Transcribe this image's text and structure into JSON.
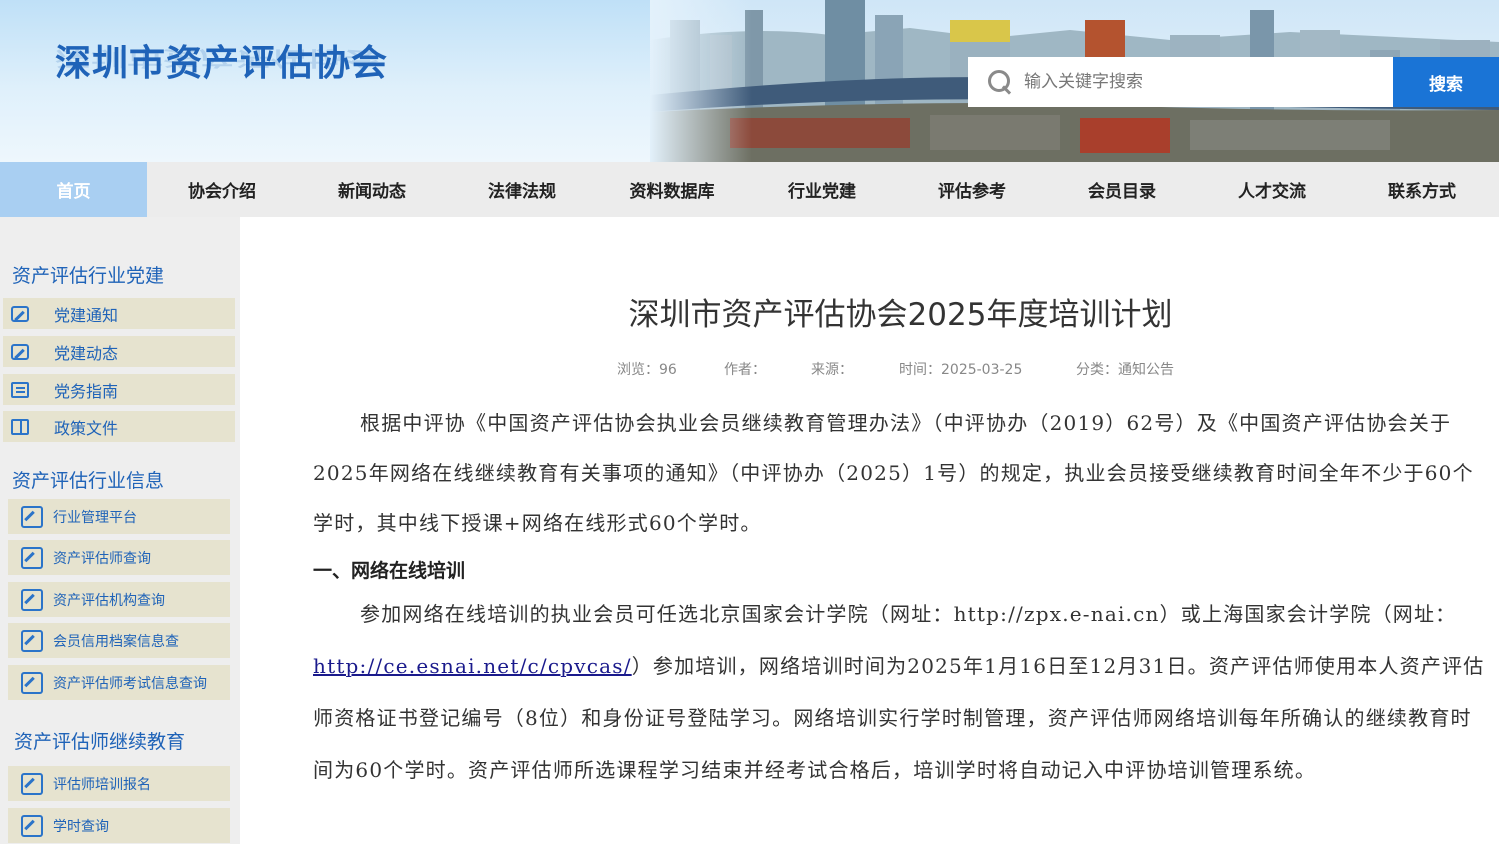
{
  "header": {
    "logo": "深圳市资产评估协会",
    "search_placeholder": "输入关键字搜索",
    "search_button": "搜索"
  },
  "nav": {
    "items": [
      "首页",
      "协会介绍",
      "新闻动态",
      "法律法规",
      "资料数据库",
      "行业党建",
      "评估参考",
      "会员目录",
      "人才交流",
      "联系方式"
    ]
  },
  "sidebar": {
    "section1": {
      "title": "资产评估行业党建",
      "items": [
        {
          "label": "党建通知",
          "icon": "edit-icon"
        },
        {
          "label": "党建动态",
          "icon": "edit-icon"
        },
        {
          "label": "党务指南",
          "icon": "document-icon"
        },
        {
          "label": "政策文件",
          "icon": "book-icon"
        }
      ]
    },
    "section2": {
      "title": "资产评估行业信息",
      "items": [
        "行业管理平台",
        "资产评估师查询",
        "资产评估机构查询",
        "会员信用档案信息查",
        "资产评估师考试信息查询"
      ]
    },
    "section3": {
      "title": "资产评估师继续教育",
      "items": [
        "评估师培训报名",
        "学时查询"
      ]
    }
  },
  "article": {
    "title": "深圳市资产评估协会2025年度培训计划",
    "meta": {
      "views": "浏览：96",
      "author": "作者：",
      "source": "来源：",
      "time": "时间：2025-03-25",
      "category": "分类：通知公告"
    },
    "para1": "根据中评协《中国资产评估协会执业会员继续教育管理办法》（中评协办（2019）62号）及《中国资产评估协会关于2025年网络在线继续教育有关事项的通知》（中评协办（2025）1号）的规定，执业会员接受继续教育时间全年不少于60个学时，其中线下授课+网络在线形式60个学时。",
    "section1_heading": "一、网络在线培训",
    "para2_before": "参加网络在线培训的执业会员可任选北京国家会计学院（网址：http://zpx.e-nai.cn）或上海国家会计学院（网址：",
    "para2_link": "http://ce.esnai.net/c/cpvcas/",
    "para2_after": "）参加培训，网络培训时间为2025年1月16日至12月31日。资产评估师使用本人资产评估师资格证书登记编号（8位）和身份证号登陆学习。网络培训实行学时制管理，资产评估师网络培训每年所确认的继续教育时间为60个学时。资产评估师所选课程学习结束并经考试合格后，培训学时将自动记入中评协培训管理系统。"
  }
}
